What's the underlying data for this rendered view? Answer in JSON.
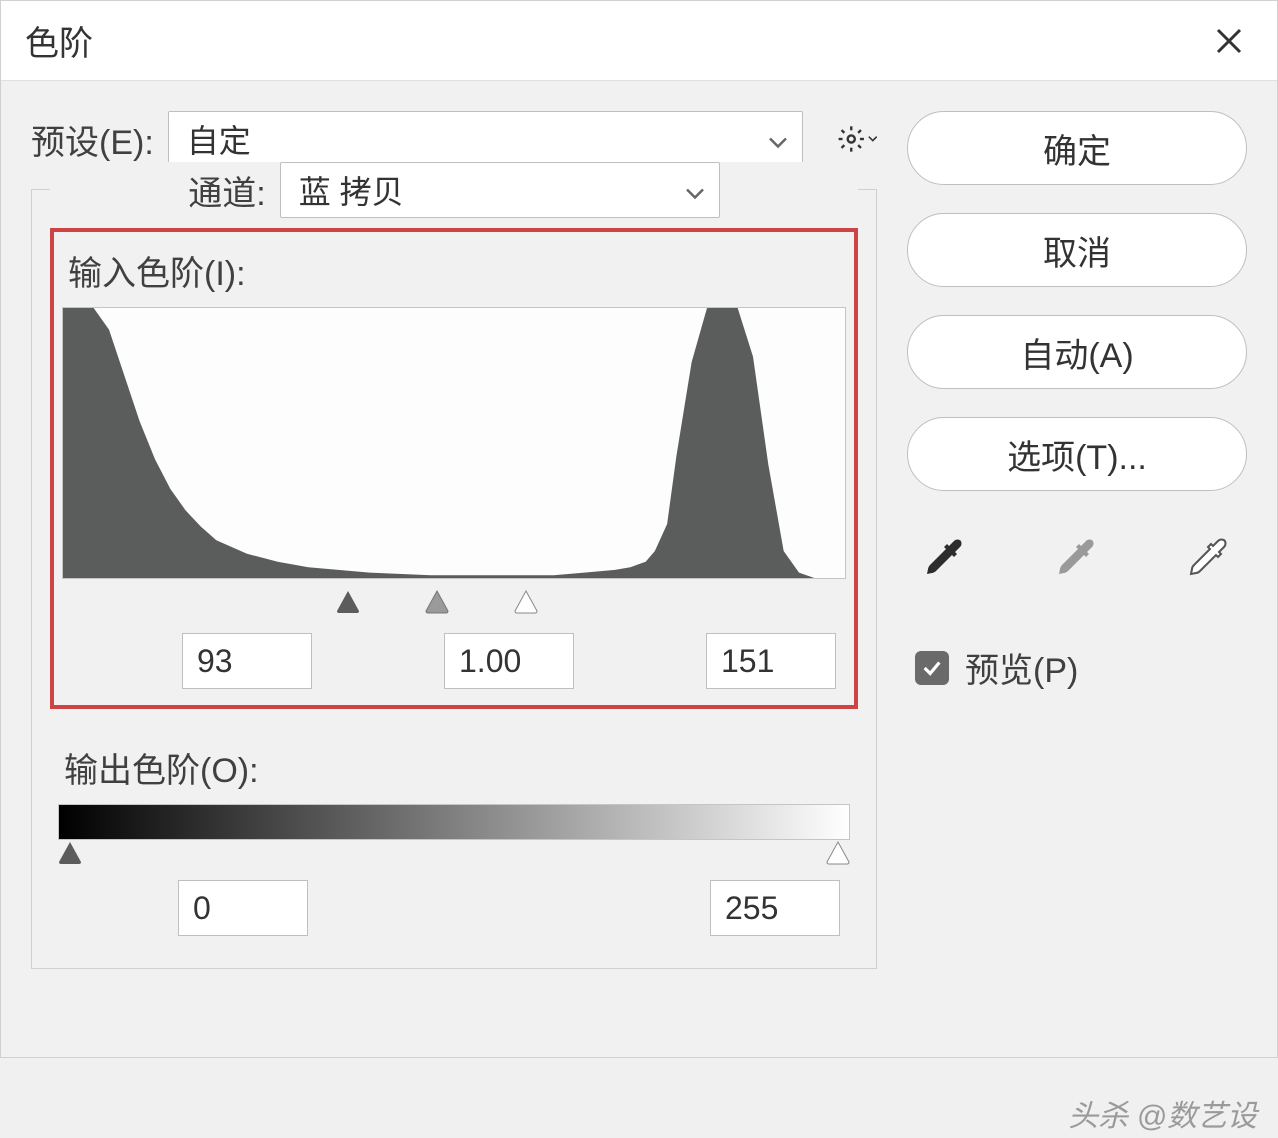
{
  "title": "色阶",
  "preset": {
    "label": "预设(E):",
    "value": "自定"
  },
  "channel": {
    "label": "通道:",
    "value": "蓝 拷贝"
  },
  "input_levels": {
    "label": "输入色阶(I):",
    "black": "93",
    "gamma": "1.00",
    "white": "151",
    "range_max": 255
  },
  "output_levels": {
    "label": "输出色阶(O):",
    "black": "0",
    "white": "255"
  },
  "buttons": {
    "ok": "确定",
    "cancel": "取消",
    "auto": "自动(A)",
    "options": "选项(T)..."
  },
  "preview": {
    "label": "预览(P)",
    "checked": true
  },
  "watermark": "头杀 @数艺设",
  "accent_red": "#ce4343",
  "chart_data": {
    "type": "area",
    "title": "输入色阶(I):",
    "xlabel": "",
    "ylabel": "",
    "xlim": [
      0,
      255
    ],
    "ylim": [
      0,
      100
    ],
    "x": [
      0,
      5,
      10,
      15,
      20,
      25,
      30,
      35,
      40,
      45,
      50,
      60,
      70,
      80,
      100,
      120,
      140,
      160,
      170,
      180,
      185,
      190,
      193,
      197,
      200,
      205,
      210,
      215,
      220,
      225,
      230,
      235,
      240,
      245,
      255
    ],
    "y": [
      100,
      100,
      100,
      92,
      75,
      58,
      44,
      33,
      25,
      19,
      14,
      9,
      6,
      4,
      2,
      1,
      1,
      1,
      2,
      3,
      4,
      6,
      10,
      20,
      45,
      80,
      100,
      100,
      100,
      82,
      42,
      10,
      2,
      0,
      0
    ],
    "sliders": {
      "black": 93,
      "gamma_pos": 122,
      "white": 151
    }
  }
}
